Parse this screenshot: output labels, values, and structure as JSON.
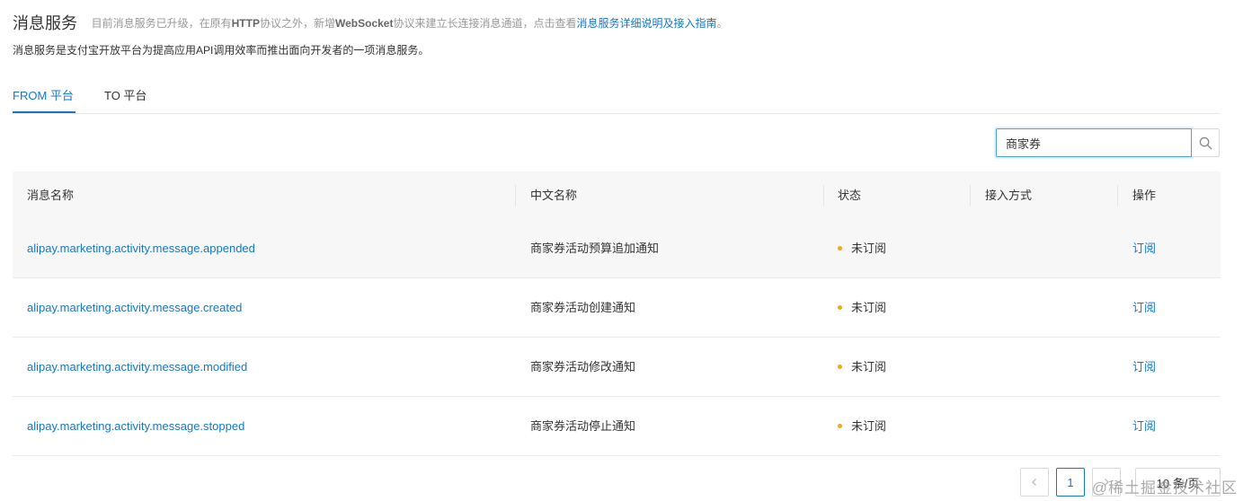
{
  "header": {
    "title": "消息服务",
    "notice_prefix": "目前消息服务已升级，在原有",
    "notice_http": "HTTP",
    "notice_mid1": "协议之外，新增",
    "notice_ws": "WebSocket",
    "notice_mid2": "协议来建立长连接消息通道，点击查看",
    "notice_link": "消息服务详细说明及接入指南",
    "notice_end": "。",
    "subtitle": "消息服务是支付宝开放平台为提高应用API调用效率而推出面向开发者的一项消息服务。"
  },
  "tabs": [
    {
      "label": "FROM 平台",
      "active": true
    },
    {
      "label": "TO 平台",
      "active": false
    }
  ],
  "search": {
    "value": "商家券"
  },
  "table": {
    "columns": [
      "消息名称",
      "中文名称",
      "状态",
      "接入方式",
      "操作"
    ],
    "rows": [
      {
        "name": "alipay.marketing.activity.message.appended",
        "cn": "商家券活动预算追加通知",
        "status": "未订阅",
        "access": "",
        "action": "订阅"
      },
      {
        "name": "alipay.marketing.activity.message.created",
        "cn": "商家券活动创建通知",
        "status": "未订阅",
        "access": "",
        "action": "订阅"
      },
      {
        "name": "alipay.marketing.activity.message.modified",
        "cn": "商家券活动修改通知",
        "status": "未订阅",
        "access": "",
        "action": "订阅"
      },
      {
        "name": "alipay.marketing.activity.message.stopped",
        "cn": "商家券活动停止通知",
        "status": "未订阅",
        "access": "",
        "action": "订阅"
      }
    ]
  },
  "pagination": {
    "current": "1",
    "page_size": "10 条/页"
  },
  "watermark": "@稀土掘金技术社区",
  "colors": {
    "link": "#1677c9",
    "status_dot": "#f5a623",
    "header_bg": "#f7f7f7"
  },
  "icons": {
    "search": "search-icon",
    "prev": "chevron-left-icon",
    "next": "chevron-right-icon"
  }
}
